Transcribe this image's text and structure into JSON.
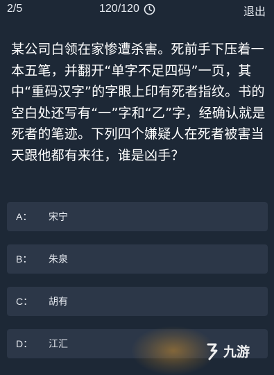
{
  "header": {
    "progress": "2/5",
    "timer": "120/120",
    "exit_label": "退出"
  },
  "question": {
    "text": "某公司白领在家惨遭杀害。死前手下压着一本五笔，并翻开“单字不足四码”一页，其中“重码汉字”的字眼上印有死者指纹。书的空白处还写有“一”字和“乙”字，经确认就是死者的笔迹。下列四个嫌疑人在死者被害当天跟他都有来往，谁是凶手？"
  },
  "options": [
    {
      "key": "A：",
      "text": "宋宁"
    },
    {
      "key": "B：",
      "text": "朱泉"
    },
    {
      "key": "C：",
      "text": "胡有"
    },
    {
      "key": "D：",
      "text": "江汇"
    }
  ],
  "watermark": {
    "text": "九游"
  },
  "colors": {
    "background": "#1d2836",
    "option_bg": "#2c3748",
    "text": "#ffffff"
  }
}
